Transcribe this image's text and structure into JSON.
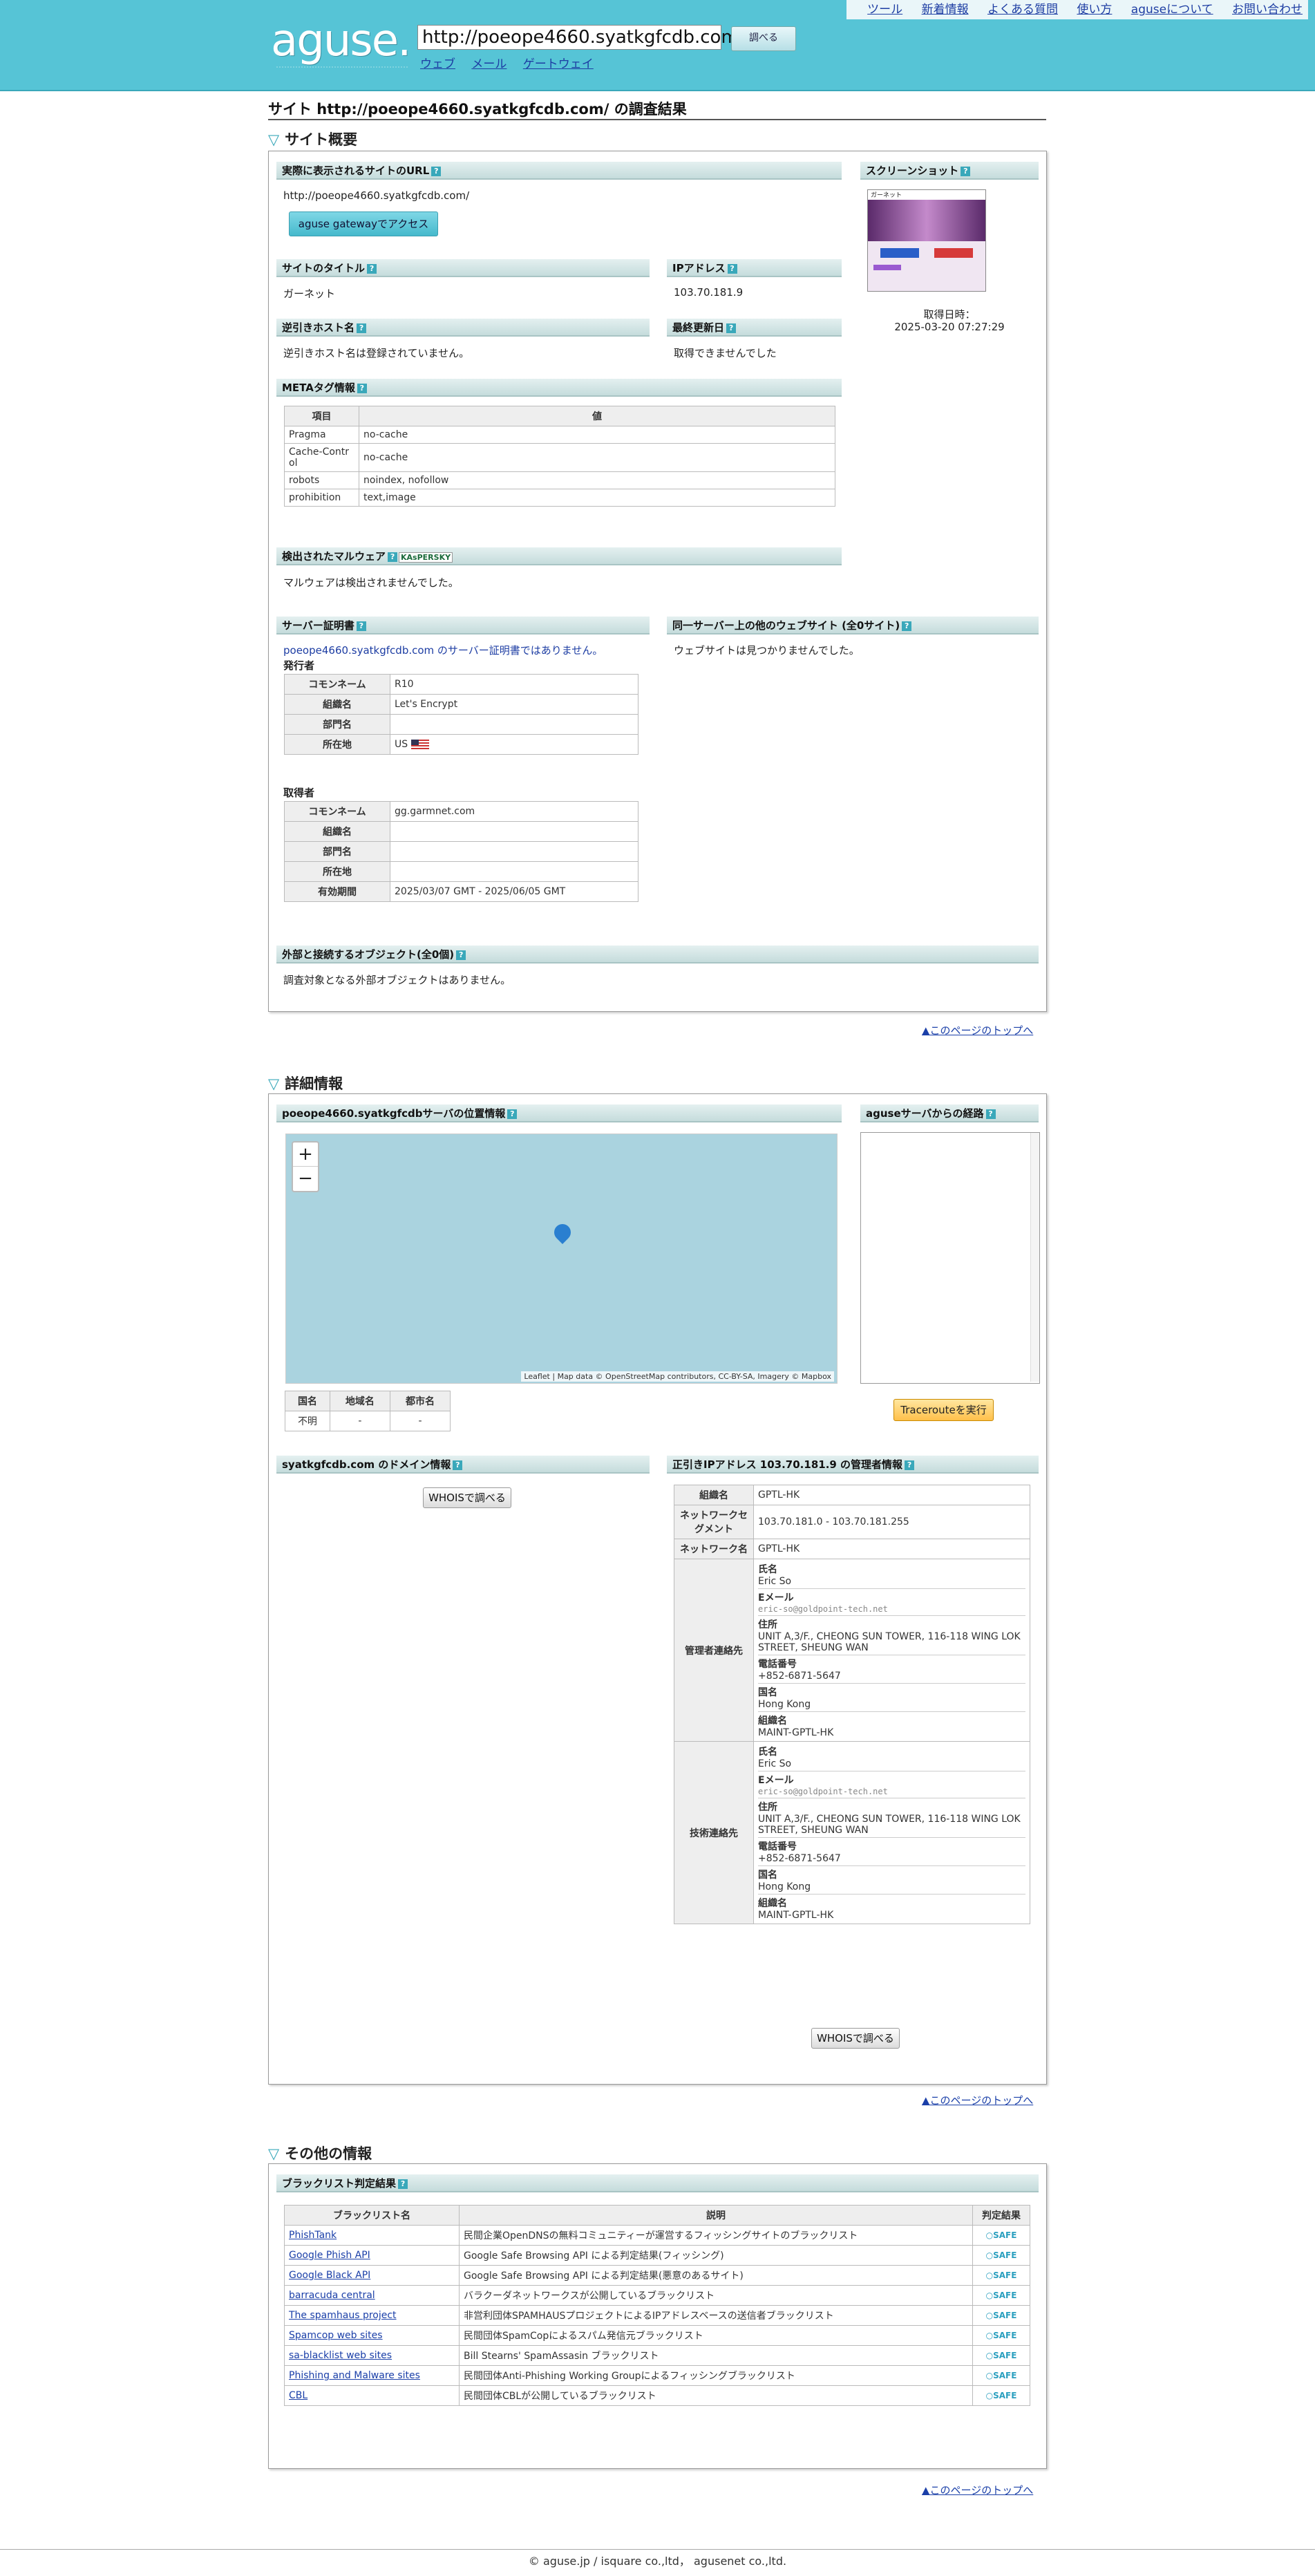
{
  "header": {
    "logo": "aguse.",
    "url_value": "http://poeope4660.syatkgfcdb.com/",
    "go_label": "調べる",
    "links": [
      "ウェブ",
      "メール",
      "ゲートウェイ"
    ],
    "topnav": [
      "ツール",
      "新着情報",
      "よくある質問",
      "使い方",
      "aguseについて",
      "お問い合わせ"
    ]
  },
  "page_title": "サイト http://poeope4660.syatkgfcdb.com/ の調査結果",
  "summary": {
    "section_title": "サイト概要",
    "real_url_label": "実際に表示されるサイトのURL",
    "real_url": "http://poeope4660.syatkgfcdb.com/",
    "gateway_button": "aguse gatewayでアクセス",
    "screenshot_label": "スクリーンショット",
    "screenshot_site": "ガーネット",
    "shot_date_label": "取得日時：",
    "shot_date": "2025-03-20 07:27:29",
    "site_title_label": "サイトのタイトル",
    "site_title": "ガーネット",
    "ip_label": "IPアドレス",
    "ip": "103.70.181.9",
    "rdns_label": "逆引きホスト名",
    "rdns": "逆引きホスト名は登録されていません。",
    "updated_label": "最終更新日",
    "updated": "取得できませんでした",
    "meta_label": "METAタグ情報",
    "meta_headers": [
      "項目",
      "値"
    ],
    "meta_rows": [
      [
        "Pragma",
        "no-cache"
      ],
      [
        "Cache-Control",
        "no-cache"
      ],
      [
        "robots",
        "noindex, nofollow"
      ],
      [
        "prohibition",
        "text,image"
      ]
    ],
    "malware_label": "検出されたマルウェア",
    "kaspersky": "KAsPERSKY",
    "malware": "マルウェアは検出されませんでした。",
    "cert_label": "サーバー証明書",
    "cert_note": "poeope4660.syatkgfcdb.com のサーバー証明書ではありません。",
    "issuer_label": "発行者",
    "issuer_rows": [
      [
        "コモンネーム",
        "R10"
      ],
      [
        "組織名",
        "Let's Encrypt"
      ],
      [
        "部門名",
        ""
      ],
      [
        "所在地",
        "US"
      ]
    ],
    "subject_label": "取得者",
    "subject_rows": [
      [
        "コモンネーム",
        "gg.garmnet.com"
      ],
      [
        "組織名",
        ""
      ],
      [
        "部門名",
        ""
      ],
      [
        "所在地",
        ""
      ],
      [
        "有効期間",
        "2025/03/07 GMT - 2025/06/05 GMT"
      ]
    ],
    "same_server_label": "同一サーバー上の他のウェブサイト (全0サイト)",
    "same_server": "ウェブサイトは見つかりませんでした。",
    "external_label": "外部と接続するオブジェクト(全0個)",
    "external": "調査対象となる外部オブジェクトはありません。"
  },
  "pagetop": "▲このページのトップへ",
  "detail": {
    "section_title": "詳細情報",
    "location_label": "poeope4660.syatkgfcdbサーバの位置情報",
    "route_label": "aguseサーバからの経路",
    "map_attrib": "Leaflet | Map data © OpenStreetMap contributors, CC-BY-SA, Imagery © Mapbox",
    "zoom_in": "+",
    "zoom_out": "−",
    "loc_headers": [
      "国名",
      "地域名",
      "都市名"
    ],
    "loc_values": [
      "不明",
      "-",
      "-"
    ],
    "traceroute_button": "Tracerouteを実行",
    "domain_label": "syatkgfcdb.com のドメイン情報",
    "whois_button": "WHOISで調べる",
    "ipadmin_label": "正引きIPアドレス 103.70.181.9 の管理者情報",
    "org_label": "組織名",
    "org": "GPTL-HK",
    "segment_label": "ネットワークセグメント",
    "segment": "103.70.181.0 - 103.70.181.255",
    "netname_label": "ネットワーク名",
    "netname": "GPTL-HK",
    "admin_label": "管理者連絡先",
    "tech_label": "技術連絡先",
    "contact": {
      "name_label": "氏名",
      "name": "Eric So",
      "email_label": "Eメール",
      "email": "eric-so@goldpoint-tech.net",
      "addr_label": "住所",
      "addr": "UNIT A,3/F., CHEONG SUN TOWER, 116-118 WING LOK STREET, SHEUNG WAN",
      "tel_label": "電話番号",
      "tel": "+852-6871-5647",
      "country_label": "国名",
      "country": "Hong Kong",
      "org_label": "組織名",
      "org": "MAINT-GPTL-HK"
    },
    "whois_button2": "WHOISで調べる"
  },
  "other": {
    "section_title": "その他の情報",
    "blacklist_label": "ブラックリスト判定結果",
    "headers": [
      "ブラックリスト名",
      "説明",
      "判定結果"
    ],
    "rows": [
      [
        "PhishTank",
        "民間企業OpenDNSの無料コミュニティーが運営するフィッシングサイトのブラックリスト",
        "SAFE"
      ],
      [
        "Google Phish API",
        "Google Safe Browsing API による判定結果(フィッシング)",
        "SAFE"
      ],
      [
        "Google Black API",
        "Google Safe Browsing API による判定結果(悪意のあるサイト)",
        "SAFE"
      ],
      [
        "barracuda central",
        "バラクーダネットワークスが公開しているブラックリスト",
        "SAFE"
      ],
      [
        "The spamhaus project",
        "非営利団体SPAMHAUSプロジェクトによるIPアドレスベースの送信者ブラックリスト",
        "SAFE"
      ],
      [
        "Spamcop web sites",
        "民間団体SpamCopによるスパム発信元ブラックリスト",
        "SAFE"
      ],
      [
        "sa-blacklist web sites",
        "Bill Stearns' SpamAssasin ブラックリスト",
        "SAFE"
      ],
      [
        "Phishing and Malware sites",
        "民間団体Anti-Phishing Working Groupによるフィッシングブラックリスト",
        "SAFE"
      ],
      [
        "CBL",
        "民間団体CBLが公開しているブラックリスト",
        "SAFE"
      ]
    ]
  },
  "footer": "© aguse.jp / isquare co.,ltd， agusenet co.,ltd.",
  "colors": {
    "header": "#56c4d6",
    "accent": "#3aa8ba",
    "safe": "#2a9fbf"
  }
}
